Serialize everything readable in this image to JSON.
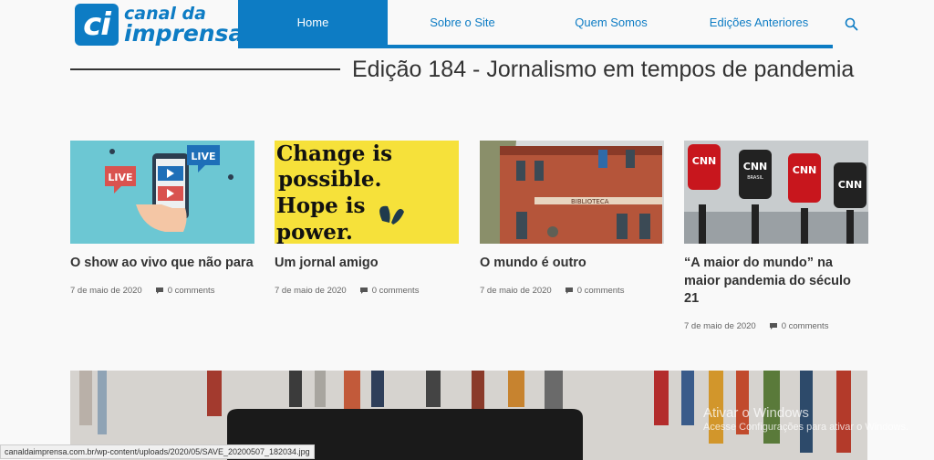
{
  "logo": {
    "mark": "ci",
    "line1": "canal da",
    "line2": "imprensa"
  },
  "nav": {
    "home": "Home",
    "sobre": "Sobre o Site",
    "quem": "Quem Somos",
    "edicoes": "Edições Anteriores",
    "search_icon": "search-icon"
  },
  "page_title": "Edição 184 - Jornalismo em tempos de pandemia",
  "cards": [
    {
      "title": "O show ao vivo que não para",
      "date": "7 de maio de 2020",
      "comments": "0 comments",
      "image_labels": [
        "LIVE",
        "LIVE"
      ]
    },
    {
      "title": "Um jornal amigo",
      "date": "7 de maio de 2020",
      "comments": "0 comments",
      "image_labels": [
        "Change is",
        "possible.",
        "Hope is",
        "power."
      ]
    },
    {
      "title": "O mundo é outro",
      "date": "7 de maio de 2020",
      "comments": "0 comments",
      "image_labels": [
        "BIBLIOTECA"
      ]
    },
    {
      "title": "“A maior do mundo” na maior pandemia do século 21",
      "date": "7 de maio de 2020",
      "comments": "0 comments",
      "image_labels": [
        "CNN",
        "CNN",
        "CNN",
        "CNN",
        "BRASIL"
      ]
    }
  ],
  "watermark": {
    "line1": "Ativar o Windows",
    "line2": "Acesse Configurações para ativar o Windows."
  },
  "status_url": "canaldaimprensa.com.br/wp-content/uploads/2020/05/SAVE_20200507_182034.jpg",
  "colors": {
    "brand": "#0d7cc4",
    "text": "#333333",
    "background": "#f9f9f9"
  }
}
